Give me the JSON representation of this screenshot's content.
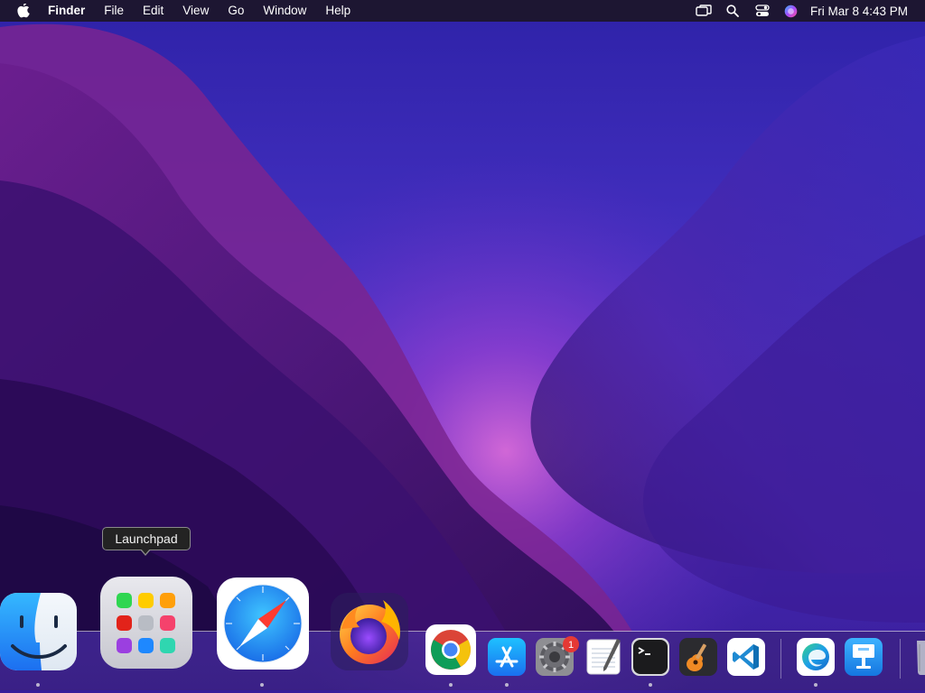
{
  "menubar": {
    "app_name": "Finder",
    "items": [
      "File",
      "Edit",
      "View",
      "Go",
      "Window",
      "Help"
    ],
    "clock": "Fri Mar 8  4:43 PM",
    "status_icons": [
      "screen-mirroring-icon",
      "spotlight-search-icon",
      "control-center-icon",
      "siri-icon"
    ]
  },
  "tooltip": {
    "label": "Launchpad"
  },
  "dock": {
    "apps": [
      {
        "name": "Finder",
        "icon": "finder-icon",
        "running": true
      },
      {
        "name": "Launchpad",
        "icon": "launchpad-icon",
        "running": false,
        "hovered": true
      },
      {
        "name": "Safari",
        "icon": "safari-icon",
        "running": true
      },
      {
        "name": "Firefox",
        "icon": "firefox-icon",
        "running": false
      },
      {
        "name": "Google Chrome",
        "icon": "chrome-icon",
        "running": true
      },
      {
        "name": "App Store",
        "icon": "app-store-icon",
        "running": true
      },
      {
        "name": "System Preferences",
        "icon": "system-preferences-icon",
        "running": false,
        "badge": "1"
      },
      {
        "name": "TextEdit",
        "icon": "textedit-icon",
        "running": false
      },
      {
        "name": "Terminal",
        "icon": "terminal-icon",
        "running": true
      },
      {
        "name": "GarageBand",
        "icon": "garageband-icon",
        "running": false
      },
      {
        "name": "Visual Studio Code",
        "icon": "vscode-icon",
        "running": false
      },
      {
        "name": "Microsoft Edge",
        "icon": "edge-icon",
        "running": true
      },
      {
        "name": "Keynote",
        "icon": "keynote-icon",
        "running": false
      },
      {
        "name": "Trash",
        "icon": "trash-icon",
        "running": false
      }
    ],
    "badge_color": "#e53935"
  },
  "colors": {
    "menubar_bg": "#1c1628",
    "wallpaper_top": "#2a1a8a",
    "wallpaper_glow": "#c24bd6"
  }
}
